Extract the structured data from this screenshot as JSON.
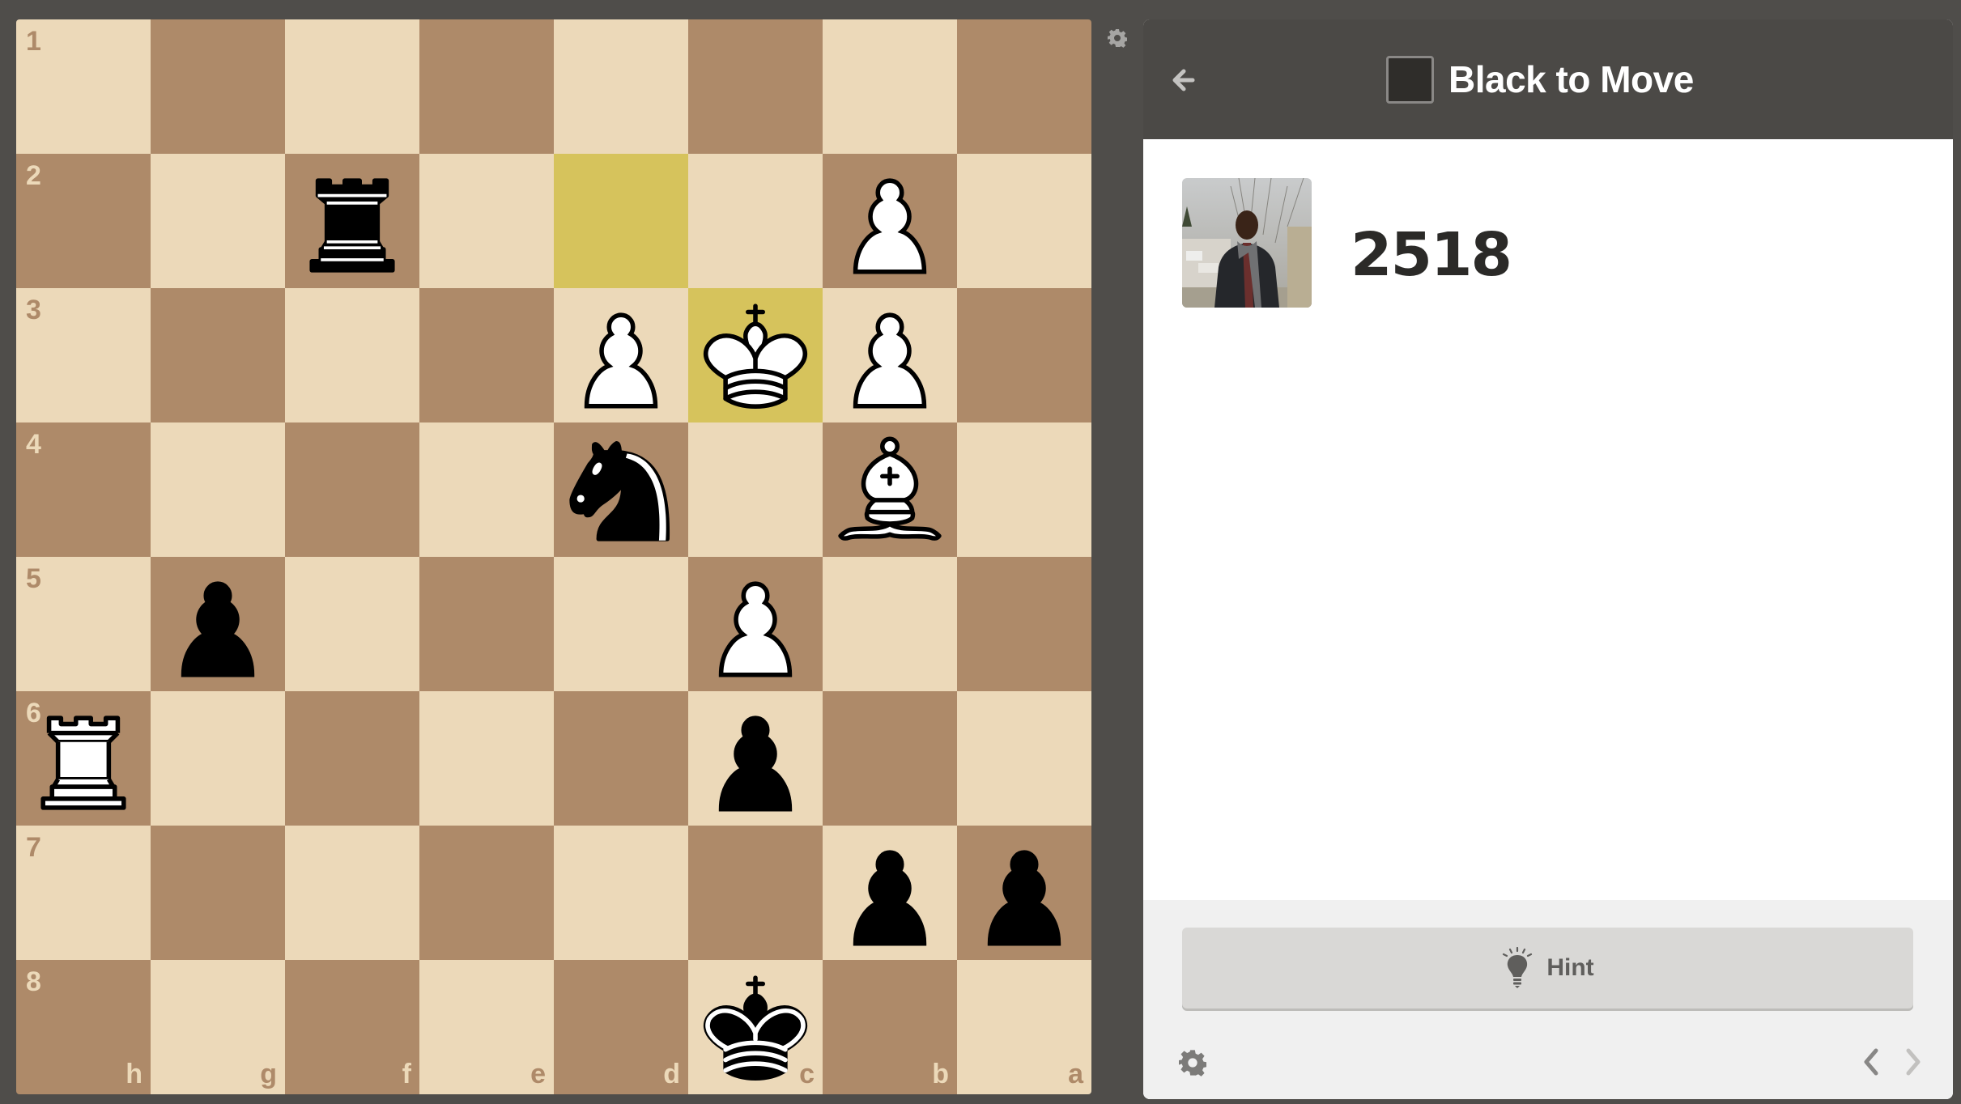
{
  "board": {
    "orientation": "black",
    "ranks_top_to_bottom": [
      "1",
      "2",
      "3",
      "4",
      "5",
      "6",
      "7",
      "8"
    ],
    "files_left_to_right": [
      "h",
      "g",
      "f",
      "e",
      "d",
      "c",
      "b",
      "a"
    ],
    "colors": {
      "light_square": "#ecd9b9",
      "dark_square": "#ae8a69",
      "highlight": "#d6c35c"
    },
    "last_move_highlight": [
      "d2",
      "c3"
    ],
    "pieces": [
      {
        "square": "f2",
        "color": "black",
        "type": "rook"
      },
      {
        "square": "b2",
        "color": "white",
        "type": "pawn"
      },
      {
        "square": "d3",
        "color": "white",
        "type": "pawn"
      },
      {
        "square": "c3",
        "color": "white",
        "type": "king"
      },
      {
        "square": "b3",
        "color": "white",
        "type": "pawn"
      },
      {
        "square": "d4",
        "color": "black",
        "type": "knight"
      },
      {
        "square": "b4",
        "color": "white",
        "type": "bishop"
      },
      {
        "square": "g5",
        "color": "black",
        "type": "pawn"
      },
      {
        "square": "c5",
        "color": "white",
        "type": "pawn"
      },
      {
        "square": "h6",
        "color": "white",
        "type": "rook"
      },
      {
        "square": "c6",
        "color": "black",
        "type": "pawn"
      },
      {
        "square": "b7",
        "color": "black",
        "type": "pawn"
      },
      {
        "square": "a7",
        "color": "black",
        "type": "pawn"
      },
      {
        "square": "c8",
        "color": "black",
        "type": "king"
      }
    ],
    "settings_icon": "gear-icon"
  },
  "panel": {
    "header": {
      "back_icon": "arrow-left-icon",
      "turn_color": "black",
      "turn_swatch_color": "#2f2d2a",
      "title": "Black to Move"
    },
    "player": {
      "avatar": "player-photo",
      "rating": "2518"
    },
    "footer": {
      "hint_label": "Hint",
      "hint_icon": "lightbulb-icon",
      "settings_icon": "gear-icon",
      "prev_icon": "chevron-left-icon",
      "next_icon": "chevron-right-icon",
      "next_disabled": true
    }
  }
}
